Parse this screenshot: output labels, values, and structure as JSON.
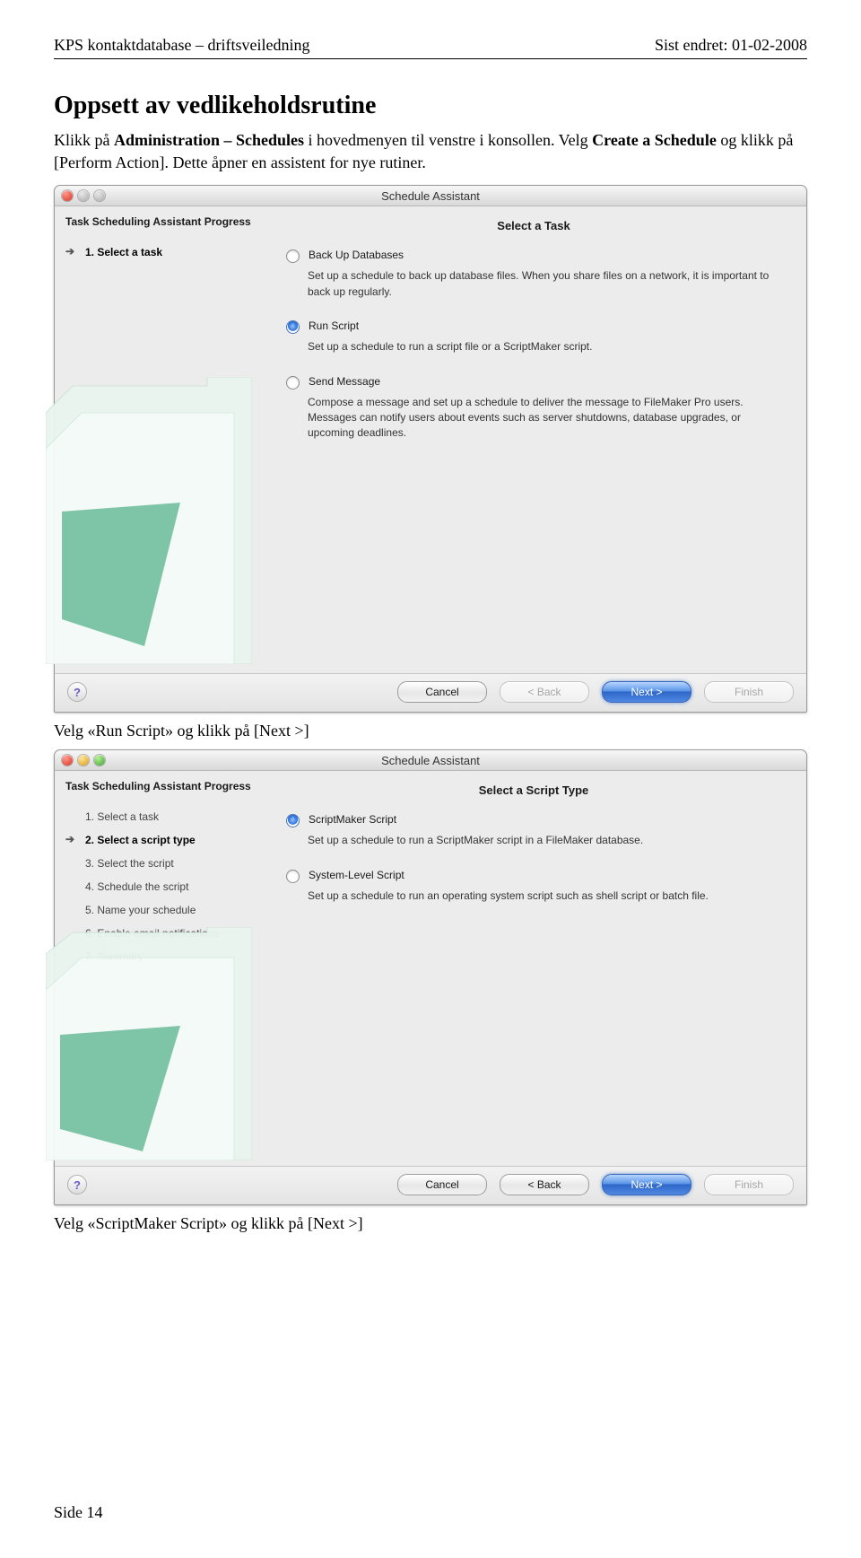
{
  "doc": {
    "header_left": "KPS kontaktdatabase – driftsveiledning",
    "header_right": "Sist endret: 01-02-2008",
    "heading": "Oppsett av vedlikeholdsrutine",
    "para1_pre": "Klikk på ",
    "para1_bold1": "Administration – Schedules",
    "para1_mid1": "  i hovedmenyen til venstre i konsollen. Velg ",
    "para1_bold2": "Create a Schedule",
    "para1_mid2": " og klikk på [Perform Action]. Dette åpner en assistent for nye rutiner.",
    "caption1": "Velg «Run Script» og klikk på [Next >]",
    "caption2": "Velg «ScriptMaker Script» og klikk på [Next >]",
    "footer": "Side 14"
  },
  "dialog1": {
    "title": "Schedule Assistant",
    "sidebar_title": "Task Scheduling Assistant Progress",
    "steps": [
      "1. Select a task"
    ],
    "pane_title": "Select a Task",
    "opt1_label": "Back Up Databases",
    "opt1_desc": "Set up a schedule to back up database files. When you share files on a network, it is important to back up regularly.",
    "opt2_label": "Run Script",
    "opt2_desc": "Set up a schedule to run a script file or a ScriptMaker script.",
    "opt3_label": "Send Message",
    "opt3_desc": "Compose a message and set up a schedule to deliver the message to FileMaker Pro users. Messages can notify users about events such as server shutdowns, database upgrades, or upcoming deadlines.",
    "btn_cancel": "Cancel",
    "btn_back": "< Back",
    "btn_next": "Next >",
    "btn_finish": "Finish"
  },
  "dialog2": {
    "title": "Schedule Assistant",
    "sidebar_title": "Task Scheduling Assistant Progress",
    "steps": [
      "1. Select a task",
      "2. Select a script type",
      "3. Select the script",
      "4. Schedule the script",
      "5. Name your schedule",
      "6. Enable email notifications",
      "7. Summary"
    ],
    "active_step_index": 1,
    "pane_title": "Select a Script Type",
    "opt1_label": "ScriptMaker Script",
    "opt1_desc": "Set up a schedule to run a ScriptMaker script in a FileMaker database.",
    "opt2_label": "System-Level Script",
    "opt2_desc": "Set up a schedule to run an operating system script such as shell script or batch file.",
    "btn_cancel": "Cancel",
    "btn_back": "< Back",
    "btn_next": "Next >",
    "btn_finish": "Finish"
  }
}
